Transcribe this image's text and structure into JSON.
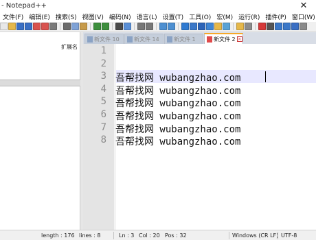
{
  "window": {
    "title": "- Notepad++",
    "close_glyph": "✕"
  },
  "menu": {
    "items": [
      "文件(F)",
      "编辑(E)",
      "搜索(S)",
      "视图(V)",
      "编码(N)",
      "语言(L)",
      "设置(T)",
      "工具(O)",
      "宏(M)",
      "运行(R)",
      "插件(P)",
      "窗口(W)",
      "?"
    ],
    "close_glyph": "X"
  },
  "toolbar": {
    "buttons": [
      {
        "name": "new-file-icon",
        "color": "#e8e8e8"
      },
      {
        "name": "open-file-icon",
        "color": "#e6b84a"
      },
      {
        "name": "save-icon",
        "color": "#3a6fc4"
      },
      {
        "name": "save-all-icon",
        "color": "#3a6fc4"
      },
      {
        "name": "close-icon",
        "color": "#d9534f"
      },
      {
        "name": "close-all-icon",
        "color": "#d9534f"
      },
      {
        "name": "print-icon",
        "color": "#7a7a7a"
      },
      {
        "name": "cut-icon",
        "color": "#6b6b6b"
      },
      {
        "name": "copy-icon",
        "color": "#7fa2d6"
      },
      {
        "name": "paste-icon",
        "color": "#c69a4a"
      },
      {
        "name": "undo-icon",
        "color": "#3d8f3d"
      },
      {
        "name": "redo-icon",
        "color": "#3d8f3d"
      },
      {
        "name": "find-icon",
        "color": "#4a4a4a"
      },
      {
        "name": "replace-icon",
        "color": "#5a8fd6"
      },
      {
        "name": "zoom-in-icon",
        "color": "#777777"
      },
      {
        "name": "zoom-out-icon",
        "color": "#777777"
      },
      {
        "name": "sync-vertical-icon",
        "color": "#4d8fd1"
      },
      {
        "name": "sync-horizontal-icon",
        "color": "#4d8fd1"
      },
      {
        "name": "word-wrap-icon",
        "color": "#2f7ad1"
      },
      {
        "name": "show-all-chars-icon",
        "color": "#3b78c8"
      },
      {
        "name": "indent-guide-icon",
        "color": "#2d64b8"
      },
      {
        "name": "user-lang-icon",
        "color": "#3f86d6"
      },
      {
        "name": "doc-map-icon",
        "color": "#e6b84a"
      },
      {
        "name": "function-list-icon",
        "color": "#5aa3d6"
      },
      {
        "name": "folder-workspace-icon",
        "color": "#e6b84a"
      },
      {
        "name": "monitoring-icon",
        "color": "#8c8c8c"
      },
      {
        "name": "record-macro-icon",
        "color": "#d63b3b"
      },
      {
        "name": "stop-record-icon",
        "color": "#555555"
      },
      {
        "name": "play-macro-icon",
        "color": "#3b78c8"
      },
      {
        "name": "run-macro-multiple-icon",
        "color": "#3b78c8"
      },
      {
        "name": "save-macro-icon",
        "color": "#3a6fc4"
      },
      {
        "name": "extra-tool-icon",
        "color": "#8a8a8a"
      }
    ]
  },
  "left_panel": {
    "column_header": "扩展名"
  },
  "tabs": [
    {
      "label": "新文件 10",
      "active": false
    },
    {
      "label": "新文件 14",
      "active": false
    },
    {
      "label": "新文件 1",
      "active": false
    },
    {
      "label": "新文件 2",
      "active": true
    }
  ],
  "editor": {
    "line_numbers": [
      "1",
      "2",
      "3",
      "4",
      "5",
      "6",
      "7",
      "8"
    ],
    "lines": [
      "",
      "",
      "吾帮找网 wubangzhao.com",
      "吾帮找网 wubangzhao.com",
      "吾帮找网 wubangzhao.com",
      "吾帮找网 wubangzhao.com",
      "吾帮找网 wubangzhao.com",
      "吾帮找网 wubangzhao.com"
    ],
    "current_line": 3
  },
  "status": {
    "length": "length : 176",
    "lines": "lines : 8",
    "ln": "Ln : 3",
    "col": "Col : 20",
    "pos": "Pos : 32",
    "eol": "Windows (CR LF)",
    "encoding": "UTF-8"
  }
}
